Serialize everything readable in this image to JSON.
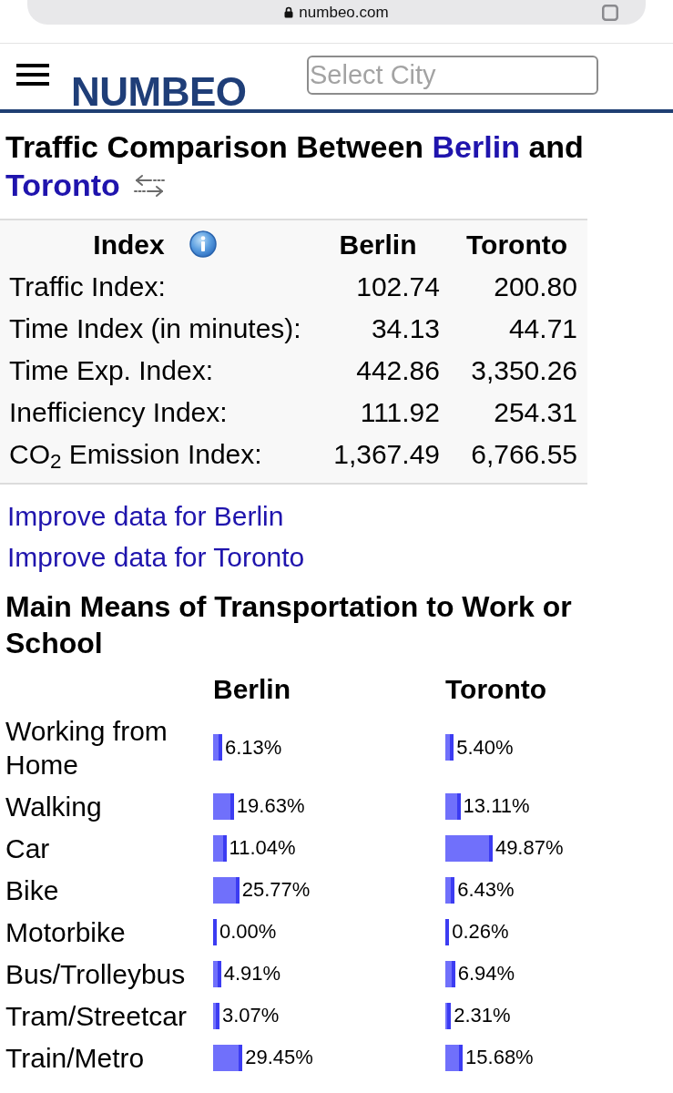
{
  "browser_bar": {
    "url": "numbeo.com"
  },
  "header": {
    "logo": "NUMBEO",
    "city_search": {
      "placeholder": "Select City"
    }
  },
  "title": {
    "text": "Traffic Comparison Between",
    "city_1": "Berlin",
    "joiner": "and",
    "city_2": "Toronto"
  },
  "index_table": {
    "columns": [
      "Index",
      "Berlin",
      "Toronto"
    ],
    "rows": [
      {
        "label": "Traffic Index:",
        "values": [
          "102.74",
          "200.80"
        ]
      },
      {
        "label": "Time Index (in minutes):",
        "values": [
          "34.13",
          "44.71"
        ]
      },
      {
        "label": "Time Exp. Index:",
        "values": [
          "442.86",
          "3,350.26"
        ]
      },
      {
        "label": "Inefficiency Index:",
        "values": [
          "111.92",
          "254.31"
        ]
      },
      {
        "label": "CO$_{2}$ Emission Index:",
        "values": [
          "1,367.49",
          "6,766.55"
        ]
      }
    ]
  },
  "improve_links": [
    "Improve data for Berlin",
    "Improve data for Toronto"
  ],
  "transport": {
    "title": "Main Means of Transportation to Work or School",
    "columns": [
      "Berlin",
      "Toronto"
    ],
    "rows": [
      {
        "label": "Working from Home",
        "cells": [
          {
            "reading": "6.13%",
            "level": 0.0613
          },
          {
            "reading": "5.40%",
            "level": 0.054
          }
        ]
      },
      {
        "label": "Walking",
        "cells": [
          {
            "reading": "19.63%",
            "level": 0.1963
          },
          {
            "reading": "13.11%",
            "level": 0.1311
          }
        ]
      },
      {
        "label": "Car",
        "cells": [
          {
            "reading": "11.04%",
            "level": 0.1104
          },
          {
            "reading": "49.87%",
            "level": 0.4987
          }
        ]
      },
      {
        "label": "Bike",
        "cells": [
          {
            "reading": "25.77%",
            "level": 0.2577
          },
          {
            "reading": "6.43%",
            "level": 0.0643
          }
        ]
      },
      {
        "label": "Motorbike",
        "cells": [
          {
            "reading": "0.00%",
            "level": 0
          },
          {
            "reading": "0.26%",
            "level": 0.0026
          }
        ]
      },
      {
        "label": "Bus/Trolleybus",
        "cells": [
          {
            "reading": "4.91%",
            "level": 0.0491
          },
          {
            "reading": "6.94%",
            "level": 0.0694
          }
        ]
      },
      {
        "label": "Tram/Streetcar",
        "cells": [
          {
            "reading": "3.07%",
            "level": 0.0307
          },
          {
            "reading": "2.31%",
            "level": 0.0231
          }
        ]
      },
      {
        "label": "Train/Metro",
        "cells": [
          {
            "reading": "29.45%",
            "level": 0.2945
          },
          {
            "reading": "15.68%",
            "level": 0.1568
          }
        ]
      }
    ]
  }
}
